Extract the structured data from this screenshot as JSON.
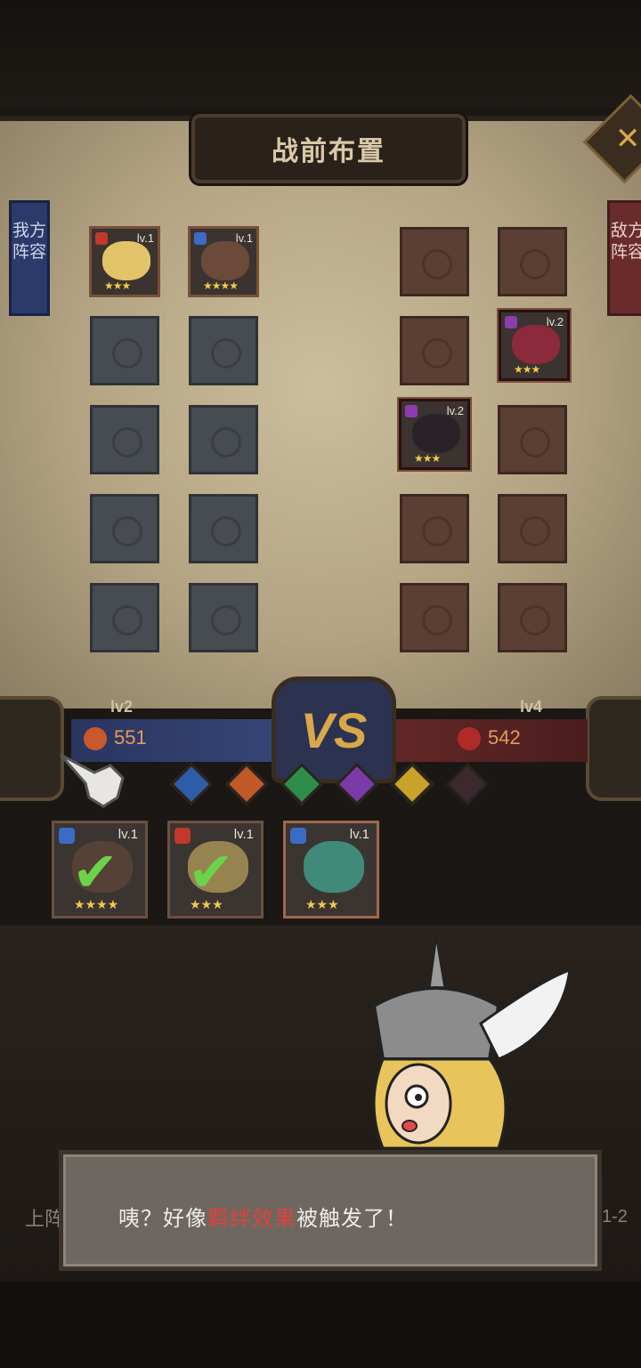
{
  "screen": {
    "title": "战前布置",
    "close_icon": "close-x-icon"
  },
  "ally_side": {
    "flag_label": "我方阵容",
    "level": "lv2",
    "power": "551",
    "color": "#3a4a7c"
  },
  "enemy_side": {
    "flag_label": "敌方阵容",
    "level": "lv4",
    "power": "542",
    "color": "#6b2a2a"
  },
  "vs_label": "VS",
  "ally_grid": [
    {
      "hero": true,
      "lv": "lv.1",
      "stars": "★★★",
      "class_color": "#c0392b",
      "portrait": "blonde-knight"
    },
    {
      "hero": true,
      "lv": "lv.1",
      "stars": "★★★★",
      "class_color": "#3b6bc4",
      "portrait": "horned-warrior"
    },
    {
      "hero": false
    },
    {
      "hero": false
    },
    {
      "hero": false
    },
    {
      "hero": false
    },
    {
      "hero": false
    },
    {
      "hero": false
    },
    {
      "hero": false
    },
    {
      "hero": false
    }
  ],
  "enemy_grid": [
    {
      "hero": false
    },
    {
      "hero": false
    },
    {
      "hero": false
    },
    {
      "hero": true,
      "lv": "lv.2",
      "stars": "★★★",
      "class_color": "#8e3bb0",
      "portrait": "one-eyed-ghoul"
    },
    {
      "hero": true,
      "lv": "lv.2",
      "stars": "★★★",
      "class_color": "#8e3bb0",
      "portrait": "dark-haired-rogue"
    },
    {
      "hero": false
    },
    {
      "hero": false
    },
    {
      "hero": false
    },
    {
      "hero": false
    },
    {
      "hero": false
    }
  ],
  "bond_icons": [
    {
      "name": "bond-blue-icon",
      "color": "#2f5ca8"
    },
    {
      "name": "bond-orange-icon",
      "color": "#c0582a"
    },
    {
      "name": "bond-green-icon",
      "color": "#2f8c4a"
    },
    {
      "name": "bond-purple-icon",
      "color": "#7a3aa8"
    },
    {
      "name": "bond-yellow-icon",
      "color": "#c9a22a"
    },
    {
      "name": "bond-dark-icon",
      "color": "#3a2a30"
    }
  ],
  "bench": [
    {
      "lv": "lv.1",
      "stars": "★★★★",
      "selected": true,
      "class_color": "#3b6bc4",
      "portrait": "horned-warrior"
    },
    {
      "lv": "lv.1",
      "stars": "★★★",
      "selected": true,
      "class_color": "#c0392b",
      "portrait": "blonde-knight"
    },
    {
      "lv": "lv.1",
      "stars": "★★★",
      "selected": false,
      "class_color": "#3b6bc4",
      "portrait": "green-haired-girl"
    }
  ],
  "dialog": {
    "text_before": "咦？好像",
    "text_highlight": "羁绊效果",
    "text_after": "被触发了！",
    "highlight_color": "#e0413a"
  },
  "background_hints": {
    "left": "上阵",
    "right": "1-2"
  }
}
